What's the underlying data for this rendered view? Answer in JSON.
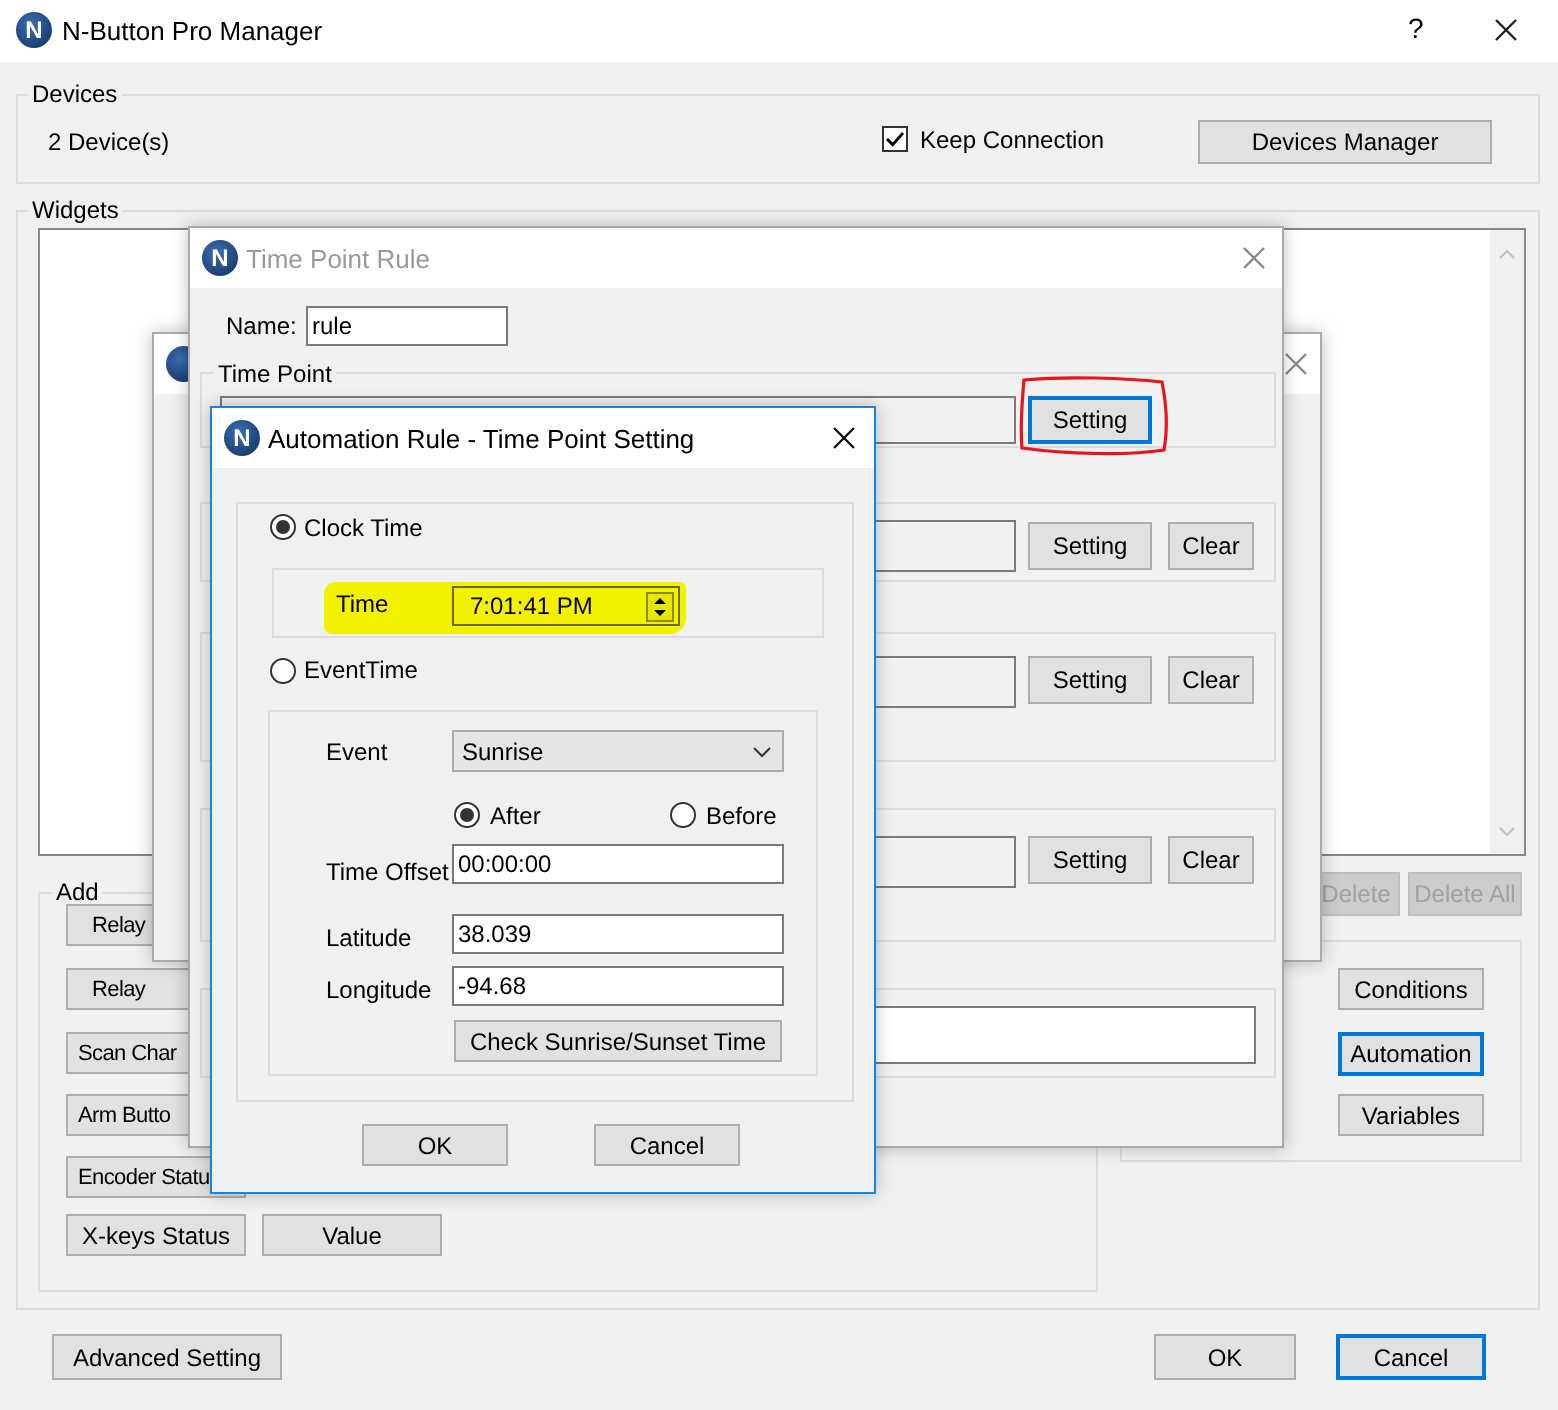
{
  "main_window": {
    "logo": "N",
    "title": "N-Button Pro Manager",
    "help": "?"
  },
  "devices": {
    "title": "Devices",
    "count": "2 Device(s)",
    "keep_connection": {
      "label": "Keep Connection",
      "checked": true
    },
    "manager_button": "Devices Manager"
  },
  "widgets": {
    "title": "Widgets",
    "list_buttons": [
      {
        "label": "Delete",
        "disabled": true
      },
      {
        "label": "Delete All",
        "disabled": true
      }
    ],
    "add": {
      "title": "Add",
      "buttons": [
        "Relay",
        "Relay",
        "Scan Char",
        "Arm Butto",
        "Encoder Statu",
        "X-keys Status",
        "Value"
      ]
    },
    "rule_buttons": [
      {
        "label": "Conditions",
        "focused": false
      },
      {
        "label": "Automation",
        "focused": true
      },
      {
        "label": "Variables",
        "focused": false
      }
    ]
  },
  "footer": {
    "buttons": [
      {
        "label": "Advanced Setting",
        "focused": false
      },
      {
        "label": "OK",
        "focused": false
      },
      {
        "label": "Cancel",
        "focused": true
      }
    ]
  },
  "rule_editor_window": {
    "active": false
  },
  "time_point_rule": {
    "logo": "N",
    "title": "Time Point Rule",
    "active": false,
    "name_label": "Name:",
    "name_value": "rule",
    "group_title": "Time Point",
    "rows": [
      {
        "kind": "action",
        "setting": {
          "label": "Setting",
          "focused": true,
          "circled": true
        }
      },
      {
        "kind": "action",
        "setting": {
          "label": "Setting",
          "focused": false
        },
        "clear": "Clear"
      },
      {
        "kind": "action",
        "setting": {
          "label": "Setting",
          "focused": false
        },
        "clear": "Clear"
      },
      {
        "kind": "action",
        "setting": {
          "label": "Setting",
          "focused": false
        },
        "clear": "Clear"
      },
      {
        "kind": "text"
      }
    ]
  },
  "time_point_setting": {
    "logo": "N",
    "title": "Automation Rule - Time Point Setting",
    "active": true,
    "modes": [
      {
        "label": "Clock Time",
        "selected": true
      },
      {
        "label": "EventTime",
        "selected": false
      }
    ],
    "time_label": "Time",
    "time_value": "7:01:41 PM",
    "time_highlighted": true,
    "event_label": "Event",
    "event_value": "Sunrise",
    "directions": [
      {
        "label": "After",
        "selected": true
      },
      {
        "label": "Before",
        "selected": false
      }
    ],
    "fields": [
      {
        "label": "Time Offset",
        "value": "00:00:00"
      },
      {
        "label": "Latitude",
        "value": "38.039"
      },
      {
        "label": "Longitude",
        "value": "-94.68"
      }
    ],
    "check_button": "Check Sunrise/Sunset Time",
    "buttons": [
      "OK",
      "Cancel"
    ]
  }
}
